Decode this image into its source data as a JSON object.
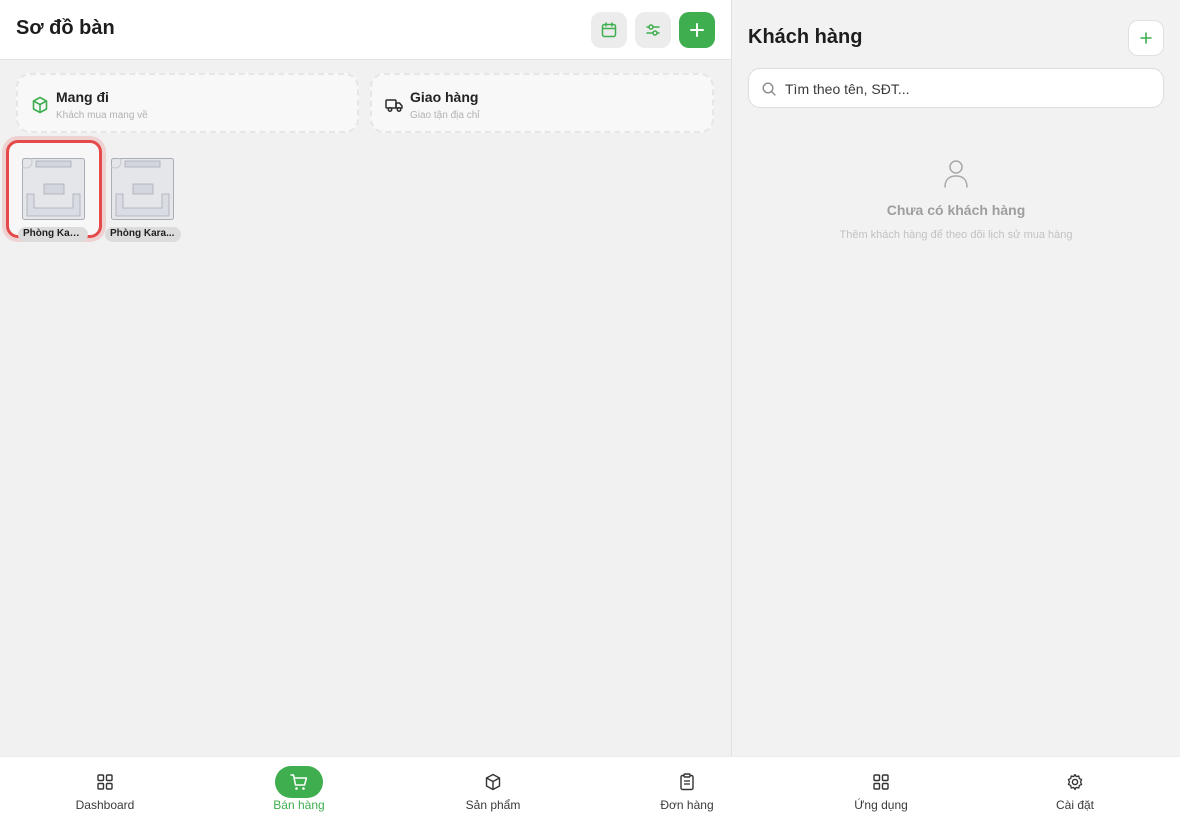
{
  "header": {
    "title": "Sơ đồ bàn",
    "icons": [
      "calendar-icon",
      "sliders-icon",
      "plus-icon"
    ]
  },
  "modes": [
    {
      "title": "Mang đi",
      "subtitle": "Khách mua mang về",
      "icon": "package-icon"
    },
    {
      "title": "Giao hàng",
      "subtitle": "Giao tận địa chỉ",
      "icon": "truck-icon"
    }
  ],
  "tables": [
    {
      "label": "Phòng Kara...",
      "selected": true
    },
    {
      "label": "Phòng Kara...",
      "selected": false
    }
  ],
  "customers": {
    "title": "Khách hàng",
    "search_placeholder": "Tìm theo tên, SĐT...",
    "empty_title": "Chưa có khách hàng",
    "empty_subtitle": "Thêm khách hàng để theo dõi lịch sử mua hàng"
  },
  "nav": {
    "items": [
      {
        "label": "Dashboard",
        "icon": "grid-icon"
      },
      {
        "label": "Bán hàng",
        "icon": "cart-icon",
        "active": true
      },
      {
        "label": "Sản phẩm",
        "icon": "box-icon"
      },
      {
        "label": "Đơn hàng",
        "icon": "clipboard-icon"
      },
      {
        "label": "Ứng dụng",
        "icon": "apps-icon"
      },
      {
        "label": "Cài đặt",
        "icon": "settings-icon"
      }
    ]
  },
  "colors": {
    "accent": "#3fae4f",
    "selected_border": "#e44a4a"
  }
}
